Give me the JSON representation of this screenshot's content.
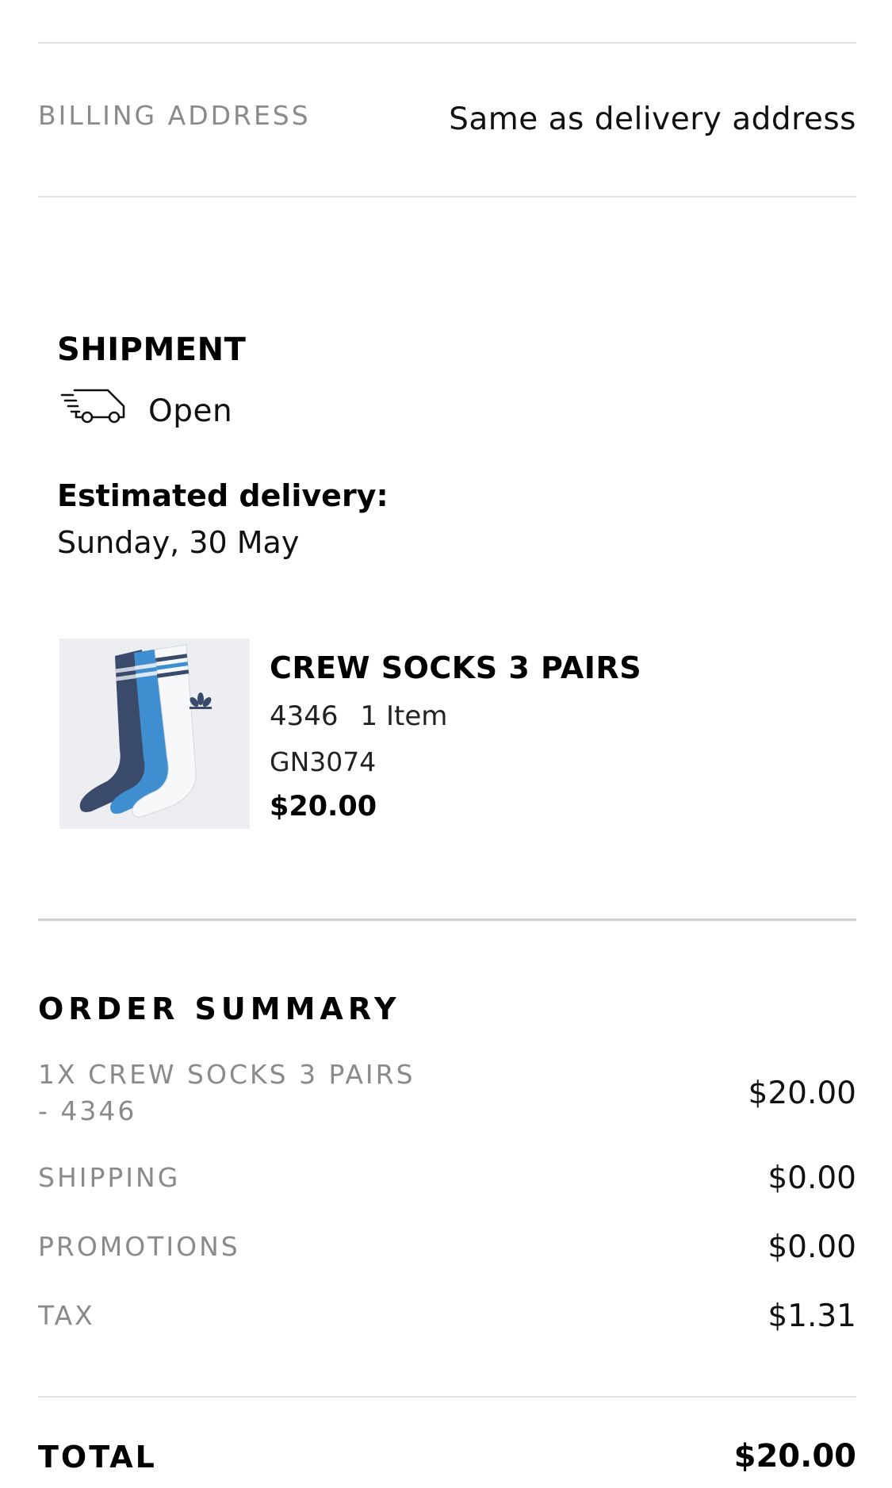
{
  "billing": {
    "label": "BILLING ADDRESS",
    "value": "Same as delivery address"
  },
  "shipment": {
    "title": "SHIPMENT",
    "status_icon": "delivery-truck-icon",
    "status": "Open",
    "estimated_label": "Estimated delivery:",
    "estimated_date": "Sunday, 30 May"
  },
  "product": {
    "name": "CREW SOCKS 3 PAIRS",
    "size": "4346",
    "quantity": "1 Item",
    "sku": "GN3074",
    "price": "$20.00",
    "image_colors": {
      "background": "#eceef1",
      "navy": "#3a4a6b",
      "blue": "#3f8fd0",
      "white": "#f7f8fa"
    }
  },
  "order_summary": {
    "title": "ORDER SUMMARY",
    "lines": [
      {
        "label_line1": "1X CREW SOCKS 3 PAIRS",
        "label_line2": "- 4346",
        "value": "$20.00"
      },
      {
        "label": "SHIPPING",
        "value": "$0.00"
      },
      {
        "label": "PROMOTIONS",
        "value": "$0.00"
      },
      {
        "label": "TAX",
        "value": "$1.31"
      }
    ],
    "total_label": "TOTAL",
    "total_value": "$20.00"
  }
}
